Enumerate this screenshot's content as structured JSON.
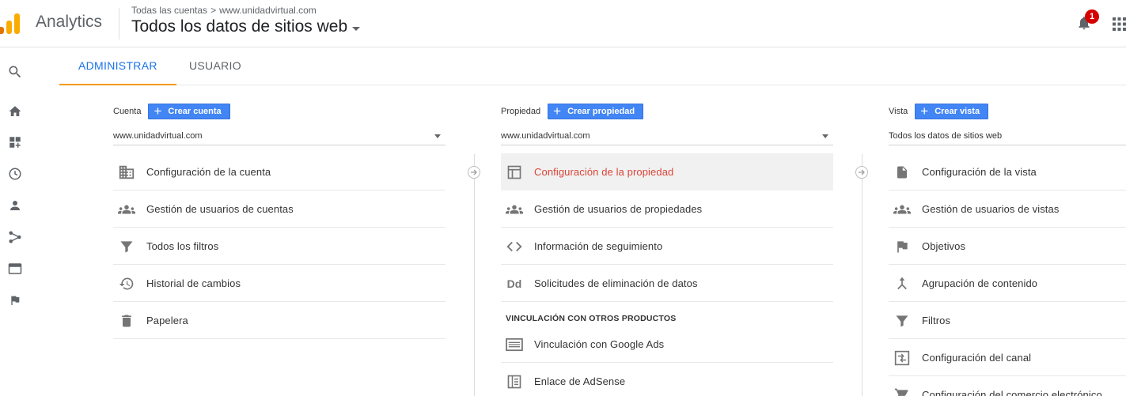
{
  "header": {
    "app_name": "Analytics",
    "breadcrumb_accounts": "Todas las cuentas",
    "breadcrumb_separator": ">",
    "breadcrumb_property": "www.unidadvirtual.com",
    "view_title": "Todos los datos de sitios web",
    "notification_count": "1"
  },
  "tabs": {
    "admin": "ADMINISTRAR",
    "user": "USUARIO"
  },
  "account": {
    "label": "Cuenta",
    "create_label": "Crear cuenta",
    "selected": "www.unidadvirtual.com",
    "items": [
      {
        "label": "Configuración de la cuenta",
        "icon": "building-icon"
      },
      {
        "label": "Gestión de usuarios de cuentas",
        "icon": "people-icon"
      },
      {
        "label": "Todos los filtros",
        "icon": "filter-icon"
      },
      {
        "label": "Historial de cambios",
        "icon": "history-icon"
      },
      {
        "label": "Papelera",
        "icon": "trash-icon"
      }
    ]
  },
  "property": {
    "label": "Propiedad",
    "create_label": "Crear propiedad",
    "selected": "www.unidadvirtual.com",
    "items": [
      {
        "label": "Configuración de la propiedad",
        "icon": "property-window-icon"
      },
      {
        "label": "Gestión de usuarios de propiedades",
        "icon": "people-icon"
      },
      {
        "label": "Información de seguimiento",
        "icon": "code-icon",
        "glyph": "<>"
      },
      {
        "label": "Solicitudes de eliminación de datos",
        "icon": "data-deletion-icon",
        "glyph": "Dd"
      }
    ],
    "section_title": "VINCULACIÓN CON OTROS PRODUCTOS",
    "linked_items": [
      {
        "label": "Vinculación con Google Ads",
        "icon": "ads-link-icon"
      },
      {
        "label": "Enlace de AdSense",
        "icon": "adsense-link-icon"
      }
    ]
  },
  "view": {
    "label": "Vista",
    "create_label": "Crear vista",
    "selected": "Todos los datos de sitios web",
    "items": [
      {
        "label": "Configuración de la vista",
        "icon": "document-icon"
      },
      {
        "label": "Gestión de usuarios de vistas",
        "icon": "people-icon"
      },
      {
        "label": "Objetivos",
        "icon": "flag-icon"
      },
      {
        "label": "Agrupación de contenido",
        "icon": "content-grouping-icon"
      },
      {
        "label": "Filtros",
        "icon": "filter-icon"
      },
      {
        "label": "Configuración del canal",
        "icon": "channel-settings-icon"
      },
      {
        "label": "Configuración del comercio electrónico",
        "icon": "cart-icon"
      }
    ]
  },
  "colors": {
    "accent_blue": "#1a73e8",
    "tab_underline": "#f29900",
    "button_blue": "#4285f4",
    "active_item_text": "#db4437",
    "badge_red": "#d50000"
  }
}
